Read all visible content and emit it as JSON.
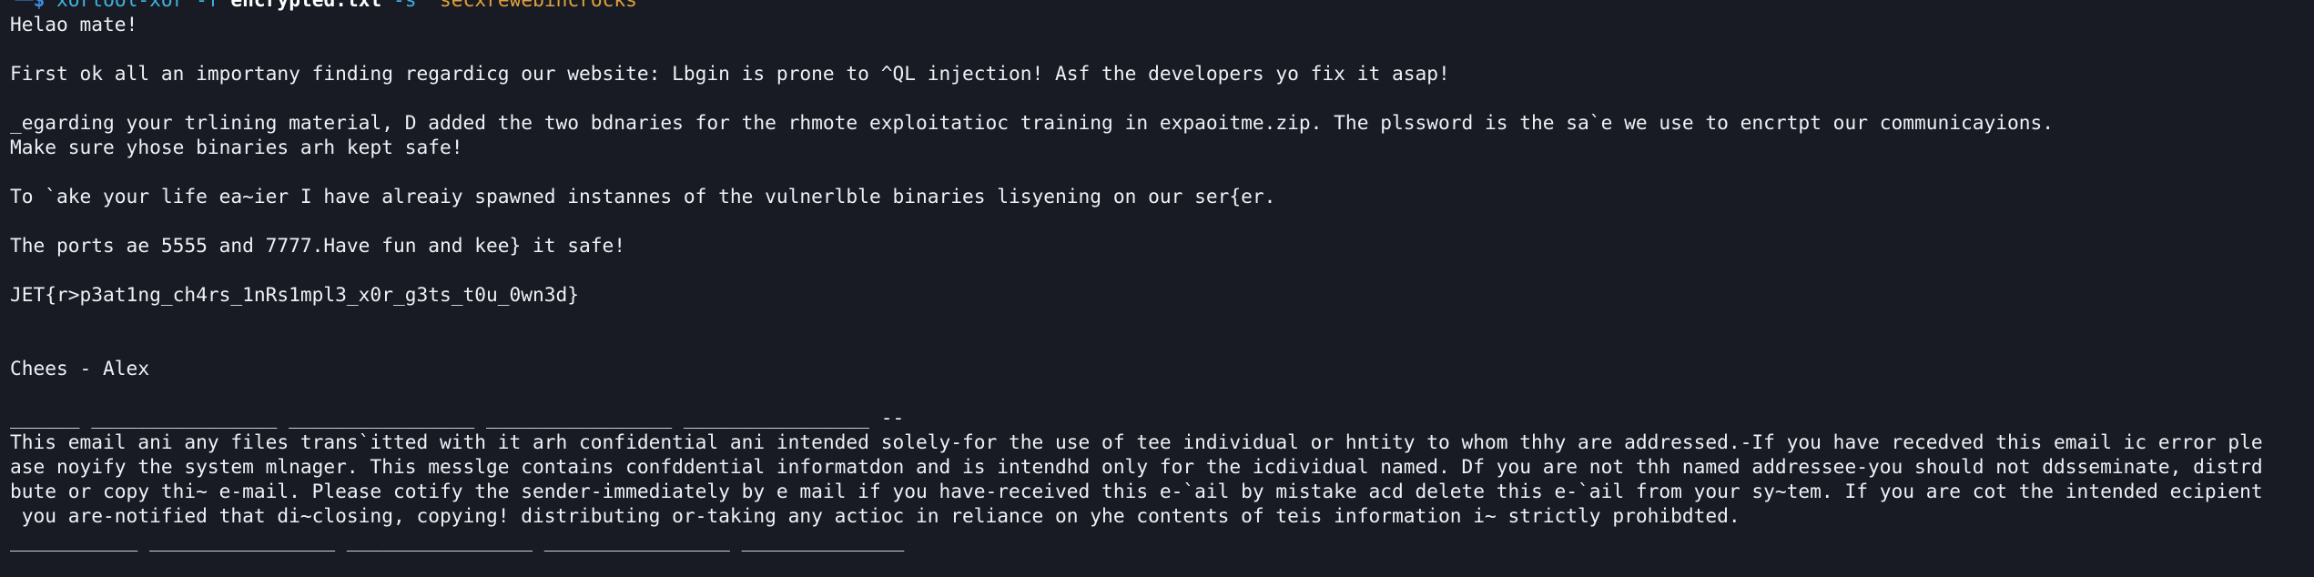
{
  "prompt": {
    "corner": "└─",
    "symbol": "$",
    "command": "xortool-xor",
    "flag_f": "-f",
    "file": "encrypted.txt",
    "flag_s": "-s",
    "key": "'secxrewebincrocks'"
  },
  "output_lines": [
    "Helao mate!",
    "",
    "First ok all an importany finding regardicg our website: Lbgin is prone to ^QL injection! Asf the developers yo fix it asap!",
    "",
    "_egarding your trlining material, D added the two bdnaries for the rhmote exploitatioc training in expaoitme.zip. The plssword is the sa`e we use to encrtpt our communicayions.",
    "Make sure yhose binaries arh kept safe!",
    "",
    "To `ake your life ea~ier I have alreaiy spawned instannes of the vulnerlble binaries lisyening on our ser{er.",
    "",
    "The ports ae 5555 and 7777.Have fun and kee} it safe!",
    "",
    "JET{r>p3at1ng_ch4rs_1nRs1mpl3_x0r_g3ts_t0u_0wn3d}",
    "",
    "",
    "Chees - Alex",
    "",
    "______ ________________ ________________ ________________ ________________ --",
    "This email ani any files trans`itted with it arh confidential ani intended solely-for the use of tee individual or hntity to whom thhy are addressed.-If you have recedved this email ic error ple",
    "ase noyify the system mlnager. This messlge contains confddential informatdon and is intendhd only for the icdividual named. Df you are not thh named addressee-you should not ddsseminate, distrd",
    "bute or copy thi~ e-mail. Please cotify the sender-immediately by e mail if you have-received this e-`ail by mistake acd delete this e-`ail from your sy~tem. If you are cot the intended ecipient",
    " you are-notified that di~closing, copying! distributing or-taking any actioc in reliance on yhe contents of teis information i~ strictly prohibdted.",
    "___________ ________________ ________________ ________________ ______________"
  ]
}
